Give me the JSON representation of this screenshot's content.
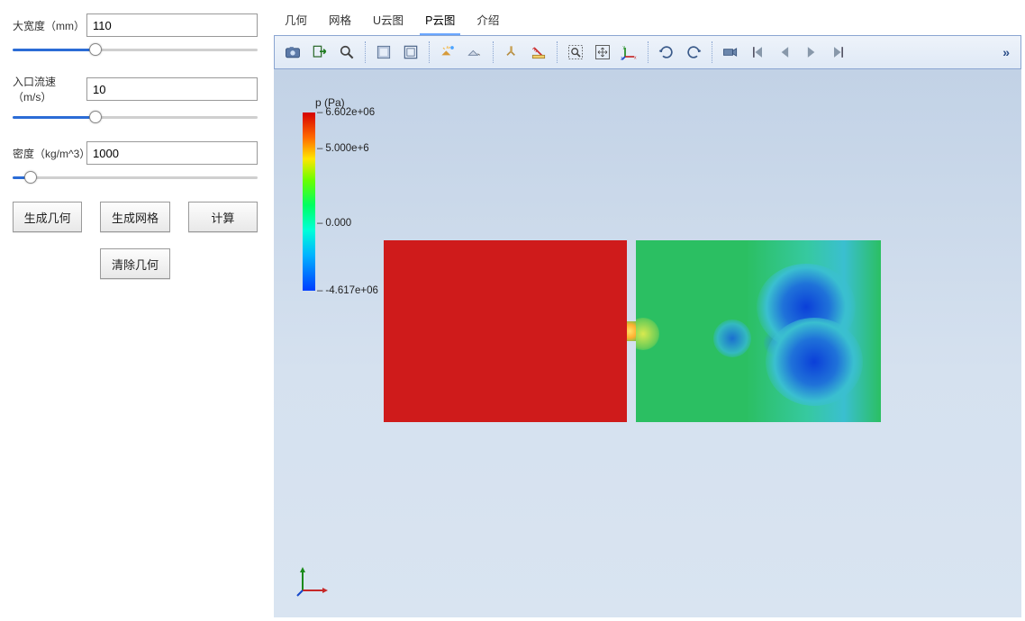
{
  "params": {
    "width": {
      "label": "大宽度（mm）",
      "value": "110",
      "slider_percent": 33
    },
    "inlet": {
      "label": "入口流速（m/s）",
      "value": "10",
      "slider_percent": 33
    },
    "density": {
      "label": "密度（kg/m^3）",
      "value": "1000",
      "slider_percent": 5
    }
  },
  "buttons": {
    "gen_geom": "生成几何",
    "gen_mesh": "生成网格",
    "compute": "计算",
    "clear_geom": "清除几何"
  },
  "tabs": {
    "geom": "几何",
    "mesh": "网格",
    "ucloud": "U云图",
    "pcloud": "P云图",
    "about": "介绍",
    "active": "pcloud"
  },
  "toolbar_overflow": "»",
  "legend": {
    "title": "p (Pa)",
    "ticks": [
      {
        "pos": 0,
        "label": "6.602e+06"
      },
      {
        "pos": 20,
        "label": "5.000e+6"
      },
      {
        "pos": 62,
        "label": "0.000"
      },
      {
        "pos": 100,
        "label": "-4.617e+06"
      }
    ]
  },
  "chart_data": {
    "type": "heatmap",
    "title": "p (Pa)",
    "value_range": [
      -4617000,
      6602000
    ],
    "colorbar_ticks": [
      6602000,
      5000000,
      0,
      -4617000
    ],
    "description": "Pressure contour over two rectangular chambers connected by a narrow orifice. Upstream (left) chamber is near maximum pressure (~6.6e6 Pa, red). Downstream (right) chamber is mostly near 0 Pa (green) with localized low-pressure vortices (~-4.6e6 Pa, blue) near the right wall."
  }
}
